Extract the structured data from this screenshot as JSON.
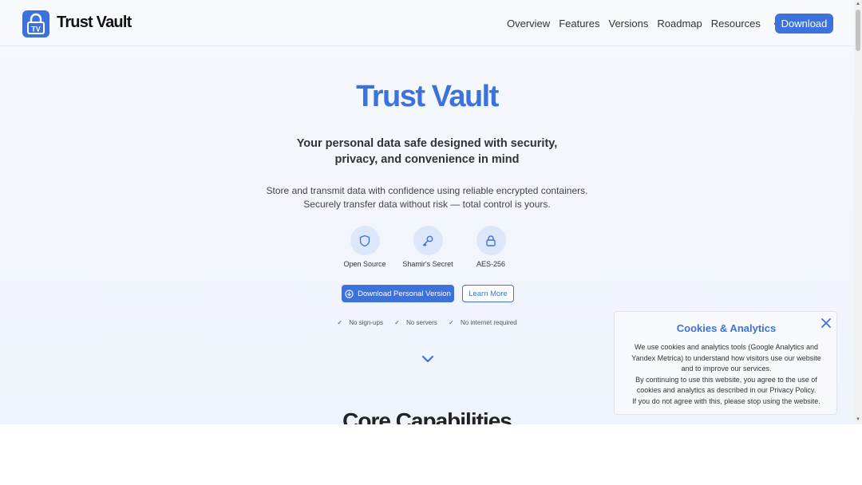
{
  "header": {
    "brand": "Trust Vault",
    "logo_text": "TV",
    "nav": {
      "overview": "Overview",
      "features": "Features",
      "versions": "Versions",
      "roadmap": "Roadmap",
      "resources": "Resources",
      "language": "en"
    },
    "download_label": "Download"
  },
  "hero": {
    "title": "Trust Vault",
    "subtitle": "Your personal data safe designed with security, privacy, and convenience in mind",
    "description": "Store and transmit data with confidence using reliable encrypted containers. Securely transfer data without risk — total control is yours.",
    "features": [
      {
        "label": "Open Source",
        "icon": "shield-icon"
      },
      {
        "label": "Shamir's Secret",
        "icon": "key-icon"
      },
      {
        "label": "AES-256",
        "icon": "lock-icon"
      }
    ],
    "primary_button": "Download Personal Version",
    "secondary_button": "Learn More",
    "checks": [
      "No sign-ups",
      "No servers",
      "No internet required"
    ]
  },
  "section": {
    "title": "Core Capabilities"
  },
  "cookie": {
    "title": "Cookies & Analytics",
    "line1": "We use cookies and analytics tools (Google Analytics and Yandex Metrica) to understand how visitors use our website and to improve our services.",
    "line2": "By continuing to use this website, you agree to the use of cookies and analytics as described in our Privacy Policy.",
    "line3": "If you do not agree with this, please stop using the website."
  },
  "colors": {
    "accent": "#3d72dd",
    "icon_bg": "#dde7fa"
  }
}
